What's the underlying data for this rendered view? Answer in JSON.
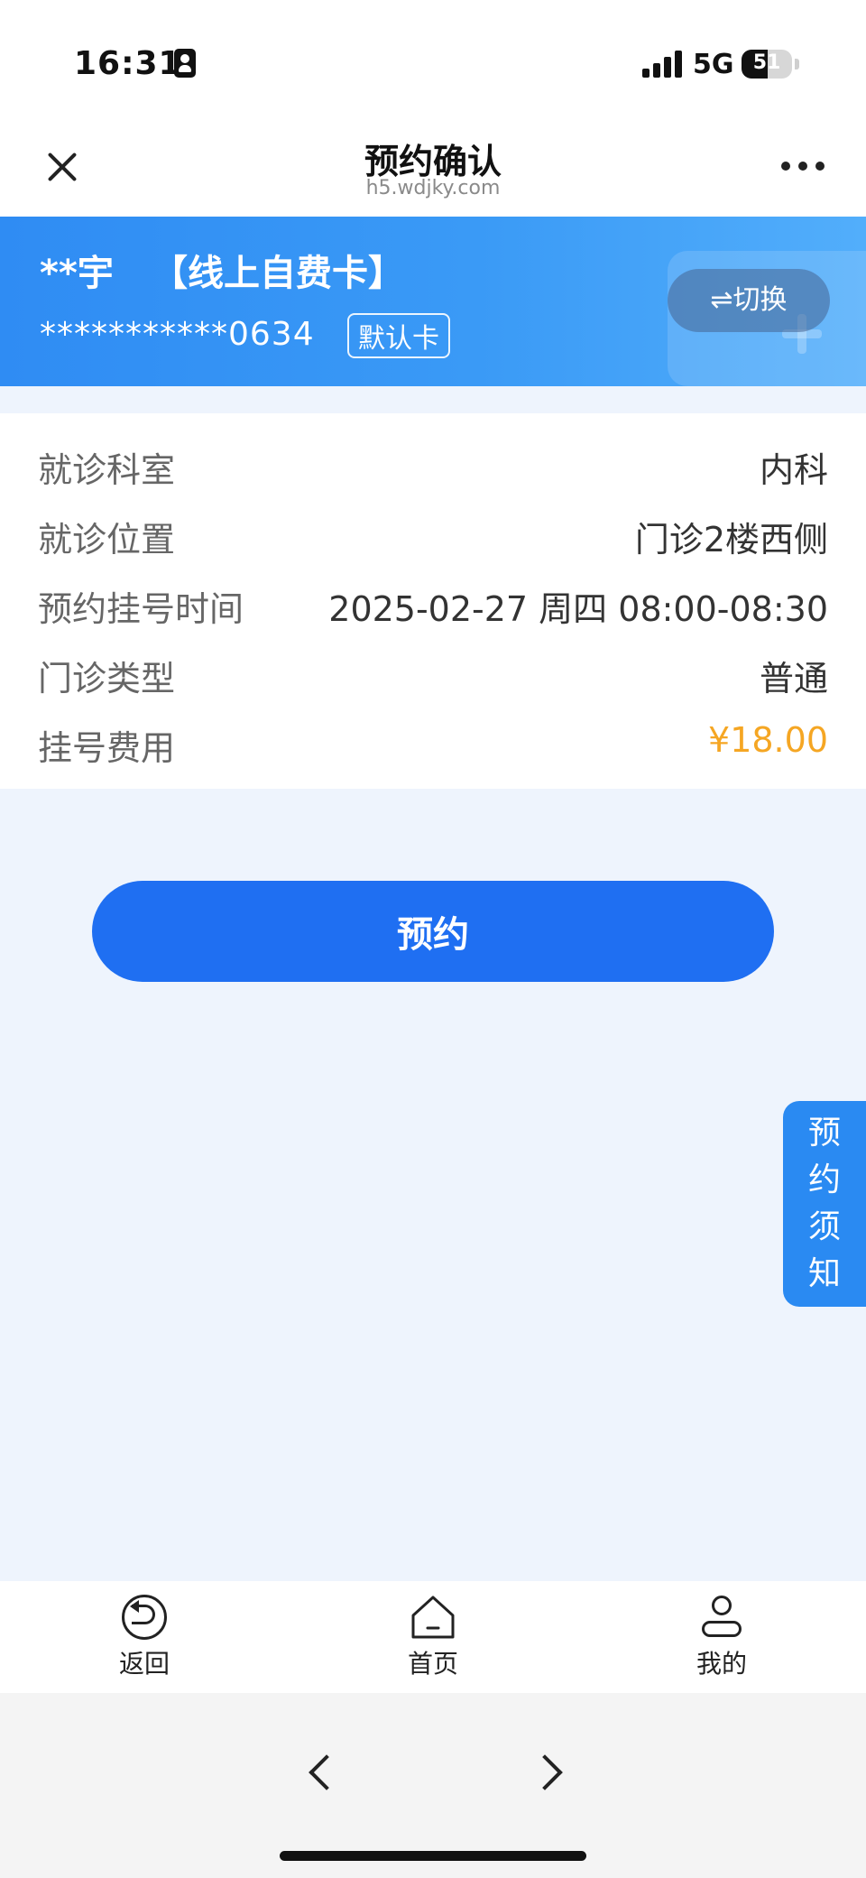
{
  "status_bar": {
    "time": "16:31",
    "network": "5G",
    "battery": 51
  },
  "nav": {
    "title": "预约确认",
    "url": "h5.wdjky.com"
  },
  "card": {
    "name": "**宇",
    "type": "【线上自费卡】",
    "number": "***********0634",
    "default_tag": "默认卡",
    "switch_label": "⇌切换"
  },
  "info": [
    {
      "label": "就诊科室",
      "value": "内科"
    },
    {
      "label": "就诊位置",
      "value": "门诊2楼西侧"
    },
    {
      "label": "预约挂号时间",
      "value": "2025-02-27 周四 08:00-08:30"
    },
    {
      "label": "门诊类型",
      "value": "普通"
    },
    {
      "label": "挂号费用",
      "value": "¥18.00"
    }
  ],
  "colors": {
    "primary": "#1f6ff2",
    "fee": "#f5a623",
    "banner": "#3a9af6"
  },
  "book_button": {
    "label": "预约"
  },
  "notice_tab": {
    "chars": [
      "预",
      "约",
      "须",
      "知"
    ]
  },
  "tab_bar": {
    "items": [
      {
        "label": "返回",
        "icon": "back-circle-icon"
      },
      {
        "label": "首页",
        "icon": "home-icon"
      },
      {
        "label": "我的",
        "icon": "user-icon"
      }
    ]
  },
  "browser": {
    "back_icon": "chevron-left-icon",
    "forward_icon": "chevron-right-icon"
  }
}
